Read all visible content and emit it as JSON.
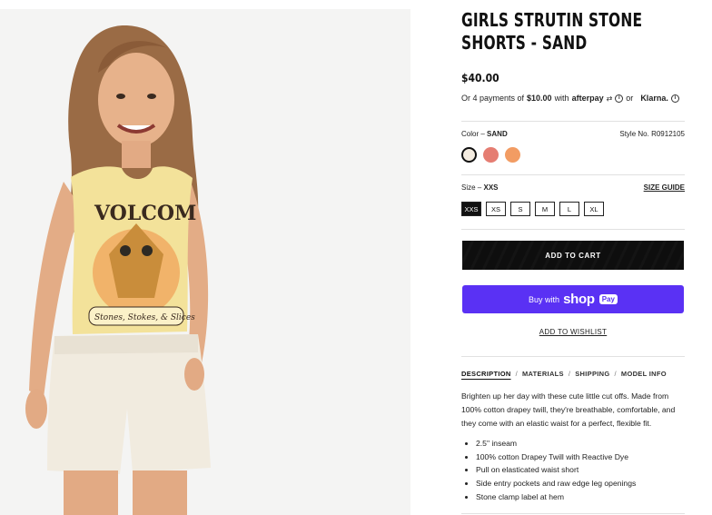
{
  "product": {
    "title": "GIRLS STRUTIN STONE SHORTS - SAND",
    "price": "$40.00",
    "image_alt": "product-photo"
  },
  "payments": {
    "prefix": "Or 4 payments of",
    "amount": "$10.00",
    "with": "with",
    "afterpay": "afterpay",
    "or": "or",
    "klarna": "Klarna."
  },
  "color": {
    "label": "Color",
    "dash": "–",
    "value": "SAND",
    "style_label": "Style No.",
    "style_no": "R0912105",
    "swatches": [
      {
        "name": "sand",
        "hex": "#f4ece0",
        "selected": true
      },
      {
        "name": "coral",
        "hex": "#e57d72",
        "selected": false
      },
      {
        "name": "orange",
        "hex": "#f29c63",
        "selected": false
      }
    ]
  },
  "size": {
    "label": "Size",
    "dash": "–",
    "value": "XXS",
    "guide": "SIZE GUIDE",
    "options": [
      "XXS",
      "XS",
      "S",
      "M",
      "L",
      "XL"
    ],
    "selected": "XXS"
  },
  "actions": {
    "add_to_cart": "ADD TO CART",
    "buy_with": "Buy with",
    "shop": "shop",
    "pay": "Pay",
    "wishlist": "ADD TO WISHLIST"
  },
  "tabs": [
    "DESCRIPTION",
    "MATERIALS",
    "SHIPPING",
    "MODEL INFO"
  ],
  "description": {
    "text": "Brighten up her day with these cute little cut offs. Made from 100% cotton drapey twill, they're breathable, comfortable, and they come with an elastic waist for a perfect, flexible fit.",
    "bullets": [
      "2.5\" inseam",
      "100% cotton Drapey Twill with Reactive Dye",
      "Pull on elasticated waist short",
      "Side entry pockets and raw edge leg openings",
      "Stone clamp label at hem"
    ]
  },
  "photo_text": {
    "shirt_logo": "VOLCOM",
    "shirt_slogan": "Stones, Stokes, & Slices"
  },
  "colors": {
    "shop_pay": "#5a31f4",
    "cart": "#0e0e0e"
  }
}
